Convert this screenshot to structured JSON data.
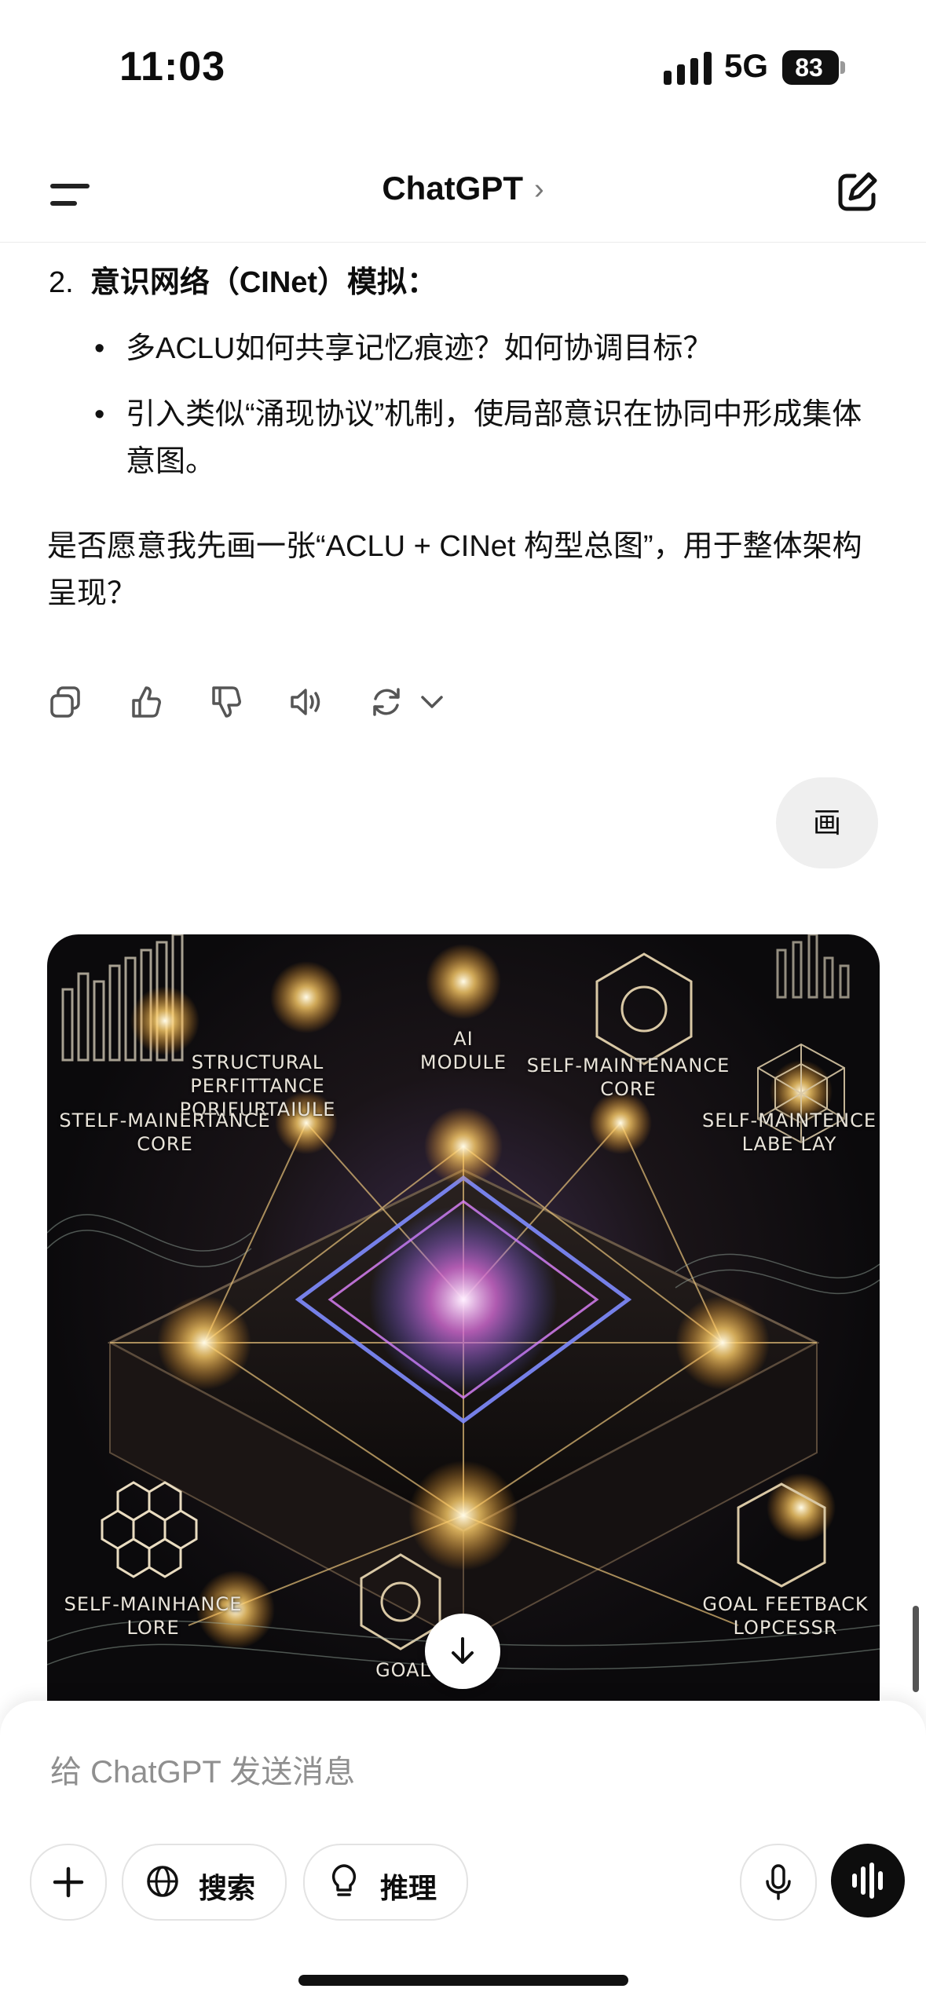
{
  "status_bar": {
    "time": "11:03",
    "network": "5G",
    "battery": "83"
  },
  "header": {
    "title": "ChatGPT",
    "chevron": "›"
  },
  "message": {
    "numbered_item_number": "2.",
    "numbered_item_title": "意识网络（CINet）模拟：",
    "bullets": [
      "多ACLU如何共享记忆痕迹？如何协调目标？",
      "引入类似“涌现协议”机制，使局部意识在协同中形成集体意图。"
    ],
    "bullet_dot": "•",
    "closing_paragraph": "是否愿意我先画一张“ACLU + CINet 构型总图”，用于整体架构呈现？"
  },
  "message_actions": [
    "copy-icon",
    "thumbs-up-icon",
    "thumbs-down-icon",
    "speaker-icon",
    "regenerate-icon",
    "chevron-down-icon"
  ],
  "user_message": "画",
  "generated_image_labels": {
    "structural": "STRUCTURAL PERFITTANCE\nPORIFURTAIULE",
    "ai_module": "AI\nMODULE",
    "self_maint_core_top": "SELF-MAINTENANCE\nCORE",
    "self_mainte_labe": "SELF-MAINTENCE\nLABE LAY",
    "stelf_mainertance": "STELF-MAINERTANCE\nCORE",
    "self_mainhance": "SELF-MAINHANCE\nLORE",
    "goal_feetback": "GOAL FEETBACK\nLOPCESSR",
    "goal_lave": "GOAL LAVE"
  },
  "composer": {
    "placeholder": "给 ChatGPT 发送消息",
    "search_label": "搜索",
    "reason_label": "推理"
  },
  "colors": {
    "accent_dark": "#0d0d0d",
    "bubble": "#efefef"
  }
}
